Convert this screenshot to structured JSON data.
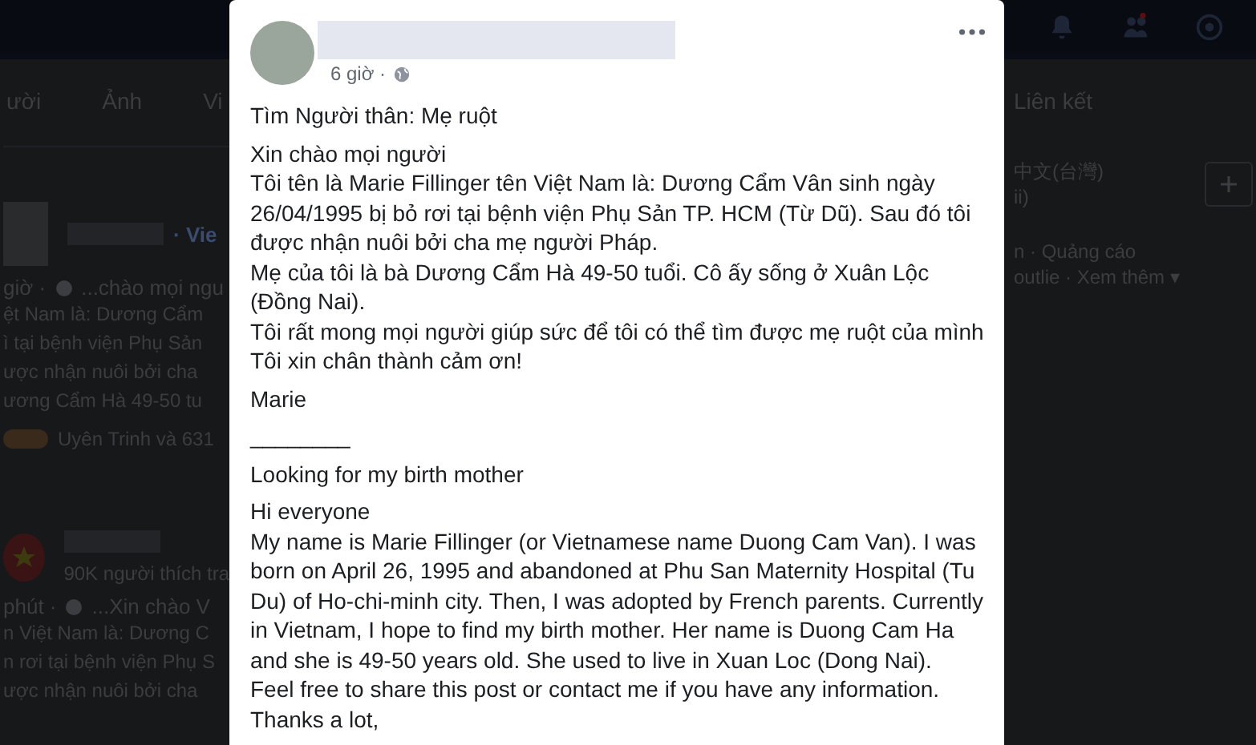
{
  "background": {
    "tabs": [
      {
        "label": "ười"
      },
      {
        "label": "Ảnh"
      },
      {
        "label": "Vi"
      }
    ],
    "right_tab": "Liên kết",
    "posts": [
      {
        "kind": "photo",
        "page": "· Vie",
        "meta": "giờ ·",
        "snippet": "...chào mọi ngu",
        "lines": [
          "ệt Nam là: Dương Cẩm",
          "ì tại bệnh viện Phụ Sản",
          "ược nhận nuôi bởi cha",
          "ương Cẩm Hà 49-50 tu"
        ],
        "reactions": "Uyên Trinh và 631"
      },
      {
        "kind": "flag",
        "likes": "90K người thích tra",
        "meta": "phút ·",
        "snippet": "...Xin chào V",
        "lines": [
          "n Việt Nam là: Dương C",
          "n rơi tại bệnh viện Phụ S",
          "ược nhận nuôi bởi cha"
        ]
      }
    ],
    "languages": [
      "中文(台灣)",
      "ii)"
    ],
    "footer": [
      "n · Quảng cáo",
      "outlie · Xem thêm ▾"
    ]
  },
  "post": {
    "time": "6 giờ ·",
    "blocks": [
      [
        "Tìm Người thân: Mẹ ruột"
      ],
      [
        "Xin chào mọi người",
        "Tôi tên là Marie Fillinger tên Việt Nam là: Dương Cẩm Vân sinh ngày 26/04/1995 bị bỏ rơi tại bệnh viện Phụ Sản TP. HCM (Từ Dũ). Sau đó tôi được nhận nuôi bởi cha mẹ người Pháp.",
        "Mẹ của tôi là bà Dương Cẩm Hà 49-50 tuổi. Cô ấy sống ở Xuân Lộc (Đồng Nai).",
        "Tôi rất mong mọi người giúp sức để tôi có thể tìm được mẹ ruột của mình",
        "Tôi xin chân thành cảm ơn!"
      ],
      [
        "Marie"
      ],
      [
        "________"
      ],
      [
        "Looking for my birth mother"
      ],
      [
        "Hi everyone",
        "My name is Marie Fillinger (or Vietnamese name Duong Cam Van). I was born on April 26, 1995 and abandoned at Phu San Maternity Hospital (Tu Du) of Ho-chi-minh city. Then, I was adopted by French parents. Currently in Vietnam, I hope to find my birth mother. Her name is Duong Cam Ha and she is 49-50 years old. She used to live in Xuan Loc (Dong Nai).",
        "Feel free to share this post or contact me if you have any information.",
        "Thanks a lot,"
      ]
    ]
  }
}
